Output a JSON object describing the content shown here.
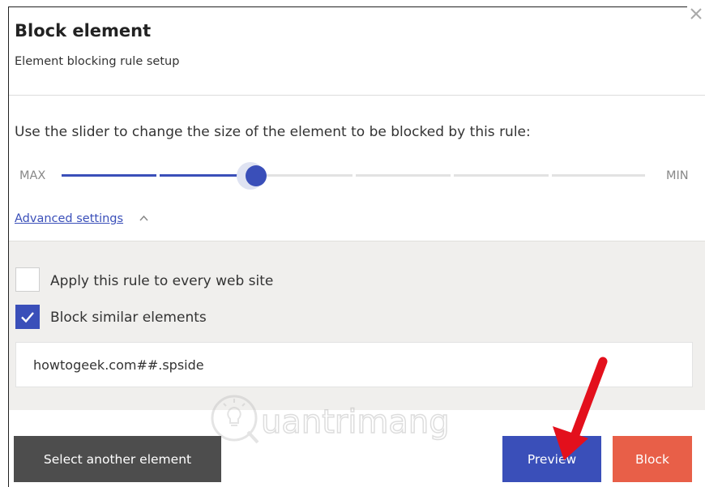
{
  "dialog": {
    "title": "Block element",
    "subtitle": "Element blocking rule setup",
    "close_icon": "close-icon"
  },
  "slider": {
    "instruction": "Use the slider to change the size of the element to be blocked by this rule:",
    "max_label": "MAX",
    "min_label": "MIN",
    "segments": 6,
    "position_fraction": 0.33
  },
  "advanced": {
    "label": "Advanced settings",
    "state": "expanded",
    "icon": "chevron-up-icon"
  },
  "options": {
    "apply_all_sites": {
      "label": "Apply this rule to every web site",
      "checked": false
    },
    "block_similar": {
      "label": "Block similar elements",
      "checked": true
    }
  },
  "rule": {
    "value": "howtogeek.com##.spside"
  },
  "buttons": {
    "select_another": "Select another element",
    "preview": "Preview",
    "block": "Block"
  },
  "watermark": {
    "text": "uantrimang"
  },
  "colors": {
    "accent": "#3a4fb9",
    "danger": "#e85f48",
    "dark_button": "#4d4d4d",
    "panel": "#f0efed",
    "annotation_arrow": "#e3101c"
  }
}
